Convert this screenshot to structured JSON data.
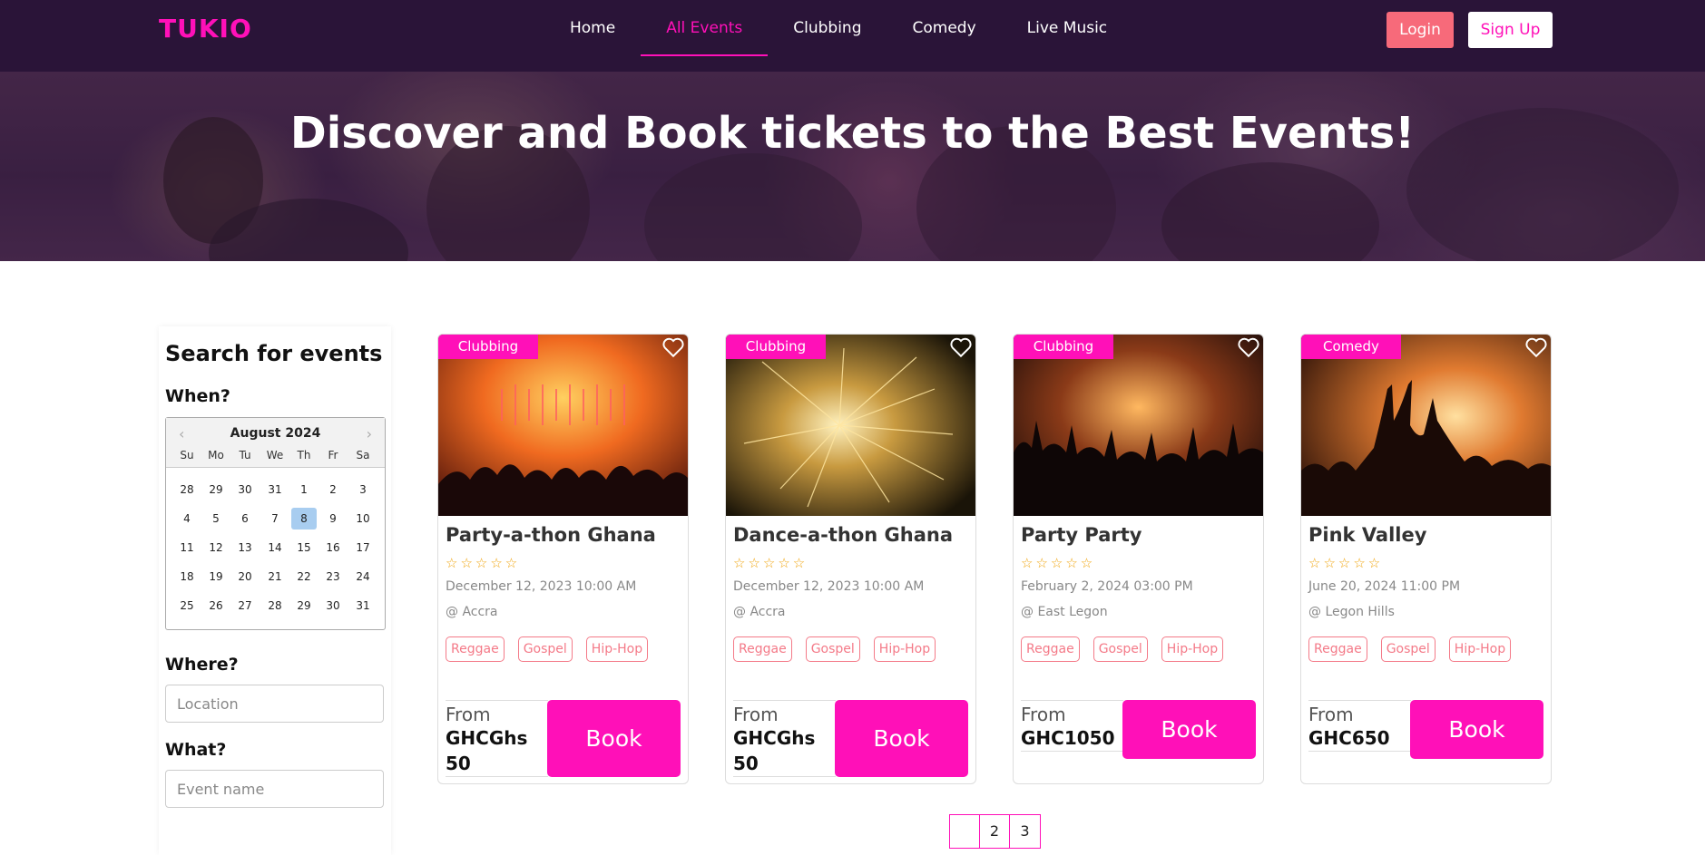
{
  "brand": {
    "logo": "TUKIO",
    "color": "#ff10b8"
  },
  "nav": {
    "links": [
      "Home",
      "All Events",
      "Clubbing",
      "Comedy",
      "Live Music"
    ],
    "active": "All Events",
    "login": "Login",
    "signup": "Sign Up"
  },
  "hero": {
    "title": "Discover and Book tickets to the Best Events!"
  },
  "sidebar": {
    "title": "Search for events",
    "when_label": "When?",
    "where_label": "Where?",
    "what_label": "What?",
    "location_placeholder": "Location",
    "event_placeholder": "Event name",
    "calendar": {
      "month": "August 2024",
      "prev_icon": "‹",
      "next_icon": "›",
      "weekdays": [
        "Su",
        "Mo",
        "Tu",
        "We",
        "Th",
        "Fr",
        "Sa"
      ],
      "weeks": [
        [
          "28",
          "29",
          "30",
          "31",
          "1",
          "2",
          "3"
        ],
        [
          "4",
          "5",
          "6",
          "7",
          "8",
          "9",
          "10"
        ],
        [
          "11",
          "12",
          "13",
          "14",
          "15",
          "16",
          "17"
        ],
        [
          "18",
          "19",
          "20",
          "21",
          "22",
          "23",
          "24"
        ],
        [
          "25",
          "26",
          "27",
          "28",
          "29",
          "30",
          "31"
        ]
      ],
      "selected": "8"
    }
  },
  "events": [
    {
      "category": "Clubbing",
      "name": "Party-a-thon Ghana",
      "rating": "☆☆☆☆☆",
      "date": "December 12, 2023 10:00 AM",
      "location": "@ Accra",
      "tags": [
        "Reggae",
        "Gospel",
        "Hip-Hop"
      ],
      "from": "From",
      "price": "GHCGhs 50",
      "book": "Book",
      "image": "concert-stage-red-lights"
    },
    {
      "category": "Clubbing",
      "name": "Dance-a-thon Ghana",
      "rating": "☆☆☆☆☆",
      "date": "December 12, 2023 10:00 AM",
      "location": "@ Accra",
      "tags": [
        "Reggae",
        "Gospel",
        "Hip-Hop"
      ],
      "from": "From",
      "price": "GHCGhs 50",
      "book": "Book",
      "image": "sparkler-fireworks"
    },
    {
      "category": "Clubbing",
      "name": "Party Party",
      "rating": "☆☆☆☆☆",
      "date": "February 2, 2024 03:00 PM",
      "location": "@ East Legon",
      "tags": [
        "Reggae",
        "Gospel",
        "Hip-Hop"
      ],
      "from": "From",
      "price": "GHC1050",
      "book": "Book",
      "image": "concert-crowd-orange"
    },
    {
      "category": "Comedy",
      "name": "Pink Valley",
      "rating": "☆☆☆☆☆",
      "date": "June 20, 2024 11:00 PM",
      "location": "@ Legon Hills",
      "tags": [
        "Reggae",
        "Gospel",
        "Hip-Hop"
      ],
      "from": "From",
      "price": "GHC650",
      "book": "Book",
      "image": "festival-sunset-crowd"
    }
  ],
  "pagination": {
    "pages": [
      "",
      "2",
      "3"
    ]
  },
  "icons": {
    "heart": "heart-outline-icon"
  }
}
